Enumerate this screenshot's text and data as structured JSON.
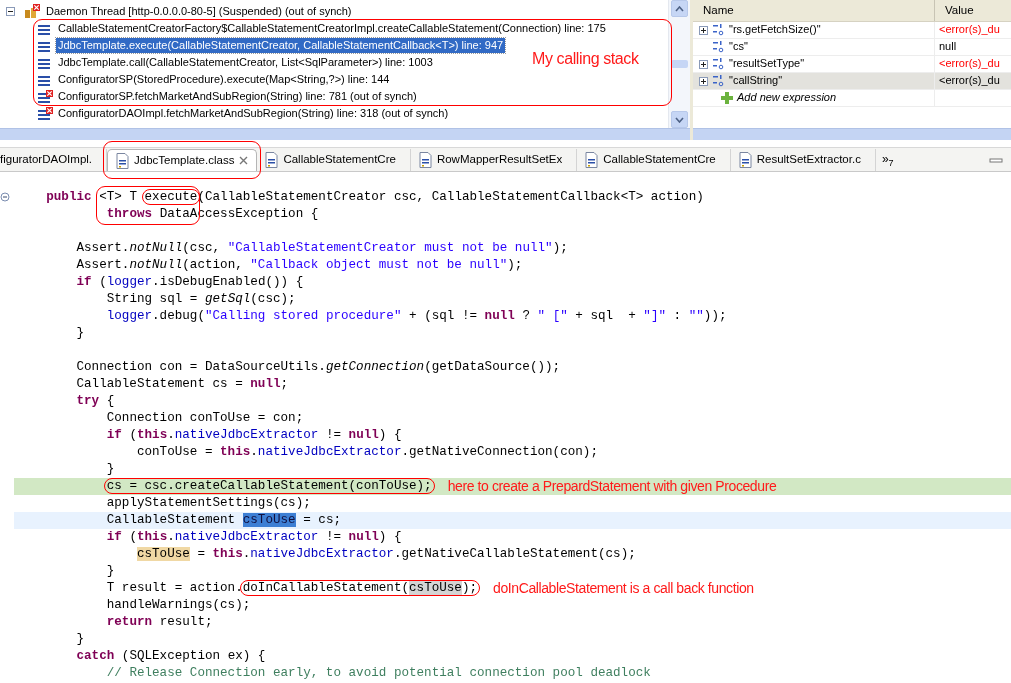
{
  "debug": {
    "threads": [
      {
        "label": "Daemon Thread [http-0.0.0.0-80-5] (Suspended) (out of synch)",
        "expanded": true,
        "out_of_synch": true,
        "children": [
          {
            "label": "CallableStatementCreatorFactory$CallableStatementCreatorImpl.createCallableStatement(Connection) line: 175",
            "selected": false,
            "out_of_synch": false,
            "circle": true
          },
          {
            "label": "JdbcTemplate.execute(CallableStatementCreator, CallableStatementCallback<T>) line: 947",
            "selected": true,
            "out_of_synch": false,
            "circle": true
          },
          {
            "label": "JdbcTemplate.call(CallableStatementCreator, List<SqlParameter>) line: 1003",
            "selected": false,
            "out_of_synch": false,
            "circle": true
          },
          {
            "label": "ConfiguratorSP(StoredProcedure).execute(Map<String,?>) line: 144",
            "selected": false,
            "out_of_synch": false,
            "circle": true
          },
          {
            "label": "ConfiguratorSP.fetchMarketAndSubRegion(String) line: 781 (out of synch)",
            "selected": false,
            "out_of_synch": true,
            "circle": true
          },
          {
            "label": "ConfiguratorDAOImpl.fetchMarketAndSubRegion(String) line: 318 (out of synch)",
            "selected": false,
            "out_of_synch": true,
            "circle": false
          }
        ]
      }
    ]
  },
  "stack_note": {
    "text": "My calling stack"
  },
  "expressions": {
    "columns": [
      "Name",
      "Value"
    ],
    "rows": [
      {
        "name": "\"rs.getFetchSize()\"",
        "value": "<error(s)_du",
        "kind": "error",
        "expandable": true,
        "selected": false
      },
      {
        "name": "\"cs\"",
        "value": "null",
        "kind": "plain",
        "expandable": false,
        "selected": false
      },
      {
        "name": "\"resultSetType\"",
        "value": "<error(s)_du",
        "kind": "error",
        "expandable": true,
        "selected": false
      },
      {
        "name": "\"callString\"",
        "value": "<error(s)_du",
        "kind": "error",
        "expandable": true,
        "selected": true
      }
    ],
    "add_label": "Add new expression"
  },
  "editor": {
    "tabs": [
      {
        "label": "figuratorDAOImpl.",
        "selected": false,
        "circle": false,
        "icon": false
      },
      {
        "label": "JdbcTemplate.class",
        "selected": true,
        "circle": true,
        "icon": true
      },
      {
        "label": "CallableStatementCre",
        "selected": false,
        "circle": false,
        "icon": true
      },
      {
        "label": "RowMapperResultSetEx",
        "selected": false,
        "circle": false,
        "icon": true
      },
      {
        "label": "CallableStatementCre",
        "selected": false,
        "circle": false,
        "icon": true
      },
      {
        "label": "ResultSetExtractor.c",
        "selected": false,
        "circle": false,
        "icon": true
      }
    ],
    "overflow": {
      "glyph": "»",
      "count": "7"
    },
    "lines": [
      {
        "kind": "code",
        "tokens": [
          {
            "t": "    public",
            "kind": "kw"
          },
          {
            "t": " <T> T ",
            "kind": "plain",
            "box": true
          },
          {
            "t": "execute",
            "kind": "plain",
            "box": true,
            "circle": true
          },
          {
            "t": "(CallableStatementCreator csc, CallableStatementCallback<T> action)",
            "kind": "plain"
          }
        ]
      },
      {
        "kind": "code",
        "tokens": [
          {
            "t": "            throws",
            "kind": "kw",
            "box": true
          },
          {
            "t": " DataAccessException {",
            "kind": "plain"
          }
        ]
      },
      {
        "kind": "blank"
      },
      {
        "kind": "code",
        "tokens": [
          {
            "t": "        Assert.",
            "kind": "plain"
          },
          {
            "t": "notNull",
            "kind": "italic"
          },
          {
            "t": "(csc, ",
            "kind": "plain"
          },
          {
            "t": "\"CallableStatementCreator must not be null\"",
            "kind": "string"
          },
          {
            "t": ");",
            "kind": "plain"
          }
        ]
      },
      {
        "kind": "code",
        "tokens": [
          {
            "t": "        Assert.",
            "kind": "plain"
          },
          {
            "t": "notNull",
            "kind": "italic"
          },
          {
            "t": "(action, ",
            "kind": "plain"
          },
          {
            "t": "\"Callback object must not be null\"",
            "kind": "string"
          },
          {
            "t": ");",
            "kind": "plain"
          }
        ]
      },
      {
        "kind": "code",
        "tokens": [
          {
            "t": "        if",
            "kind": "kw"
          },
          {
            "t": " (",
            "kind": "plain"
          },
          {
            "t": "logger",
            "kind": "field"
          },
          {
            "t": ".isDebugEnabled()) {",
            "kind": "plain"
          }
        ]
      },
      {
        "kind": "code",
        "tokens": [
          {
            "t": "            String sql = ",
            "kind": "plain"
          },
          {
            "t": "getSql",
            "kind": "italic"
          },
          {
            "t": "(csc);",
            "kind": "plain"
          }
        ]
      },
      {
        "kind": "code",
        "tokens": [
          {
            "t": "            logger",
            "kind": "field"
          },
          {
            "t": ".debug(",
            "kind": "plain"
          },
          {
            "t": "\"Calling stored procedure\"",
            "kind": "string"
          },
          {
            "t": " + (sql != ",
            "kind": "plain"
          },
          {
            "t": "null",
            "kind": "kw"
          },
          {
            "t": " ? ",
            "kind": "plain"
          },
          {
            "t": "\" [\"",
            "kind": "string"
          },
          {
            "t": " + sql  + ",
            "kind": "plain"
          },
          {
            "t": "\"]\"",
            "kind": "string"
          },
          {
            "t": " : ",
            "kind": "plain"
          },
          {
            "t": "\"\"",
            "kind": "string"
          },
          {
            "t": "));",
            "kind": "plain"
          }
        ]
      },
      {
        "kind": "code",
        "tokens": [
          {
            "t": "        }",
            "kind": "plain"
          }
        ]
      },
      {
        "kind": "blank"
      },
      {
        "kind": "code",
        "tokens": [
          {
            "t": "        Connection con = DataSourceUtils.",
            "kind": "plain"
          },
          {
            "t": "getConnection",
            "kind": "italic"
          },
          {
            "t": "(getDataSource());",
            "kind": "plain"
          }
        ]
      },
      {
        "kind": "code",
        "tokens": [
          {
            "t": "        CallableStatement cs = ",
            "kind": "plain"
          },
          {
            "t": "null",
            "kind": "kw"
          },
          {
            "t": ";",
            "kind": "plain"
          }
        ]
      },
      {
        "kind": "code",
        "tokens": [
          {
            "t": "        try",
            "kind": "kw"
          },
          {
            "t": " {",
            "kind": "plain"
          }
        ]
      },
      {
        "kind": "code",
        "tokens": [
          {
            "t": "            Connection conToUse = con;",
            "kind": "plain"
          }
        ]
      },
      {
        "kind": "code",
        "tokens": [
          {
            "t": "            if",
            "kind": "kw"
          },
          {
            "t": " (",
            "kind": "plain"
          },
          {
            "t": "this",
            "kind": "kw"
          },
          {
            "t": ".",
            "kind": "plain"
          },
          {
            "t": "nativeJdbcExtractor",
            "kind": "field"
          },
          {
            "t": " != ",
            "kind": "plain"
          },
          {
            "t": "null",
            "kind": "kw"
          },
          {
            "t": ") {",
            "kind": "plain"
          }
        ]
      },
      {
        "kind": "code",
        "tokens": [
          {
            "t": "                conToUse = ",
            "kind": "plain"
          },
          {
            "t": "this",
            "kind": "kw"
          },
          {
            "t": ".",
            "kind": "plain"
          },
          {
            "t": "nativeJdbcExtractor",
            "kind": "field"
          },
          {
            "t": ".getNativeConnection(con);",
            "kind": "plain"
          }
        ]
      },
      {
        "kind": "code",
        "tokens": [
          {
            "t": "            }",
            "kind": "plain"
          }
        ]
      },
      {
        "kind": "current_line",
        "tokens": [
          {
            "t": "            cs = csc.createCallableStatement(conToUse);",
            "kind": "plain",
            "circle": true
          }
        ],
        "note": "here to create a PrepardStatement with given Procedure"
      },
      {
        "kind": "code",
        "tokens": [
          {
            "t": "            applyStatementSettings(cs);",
            "kind": "plain"
          }
        ]
      },
      {
        "kind": "cursor_line",
        "tokens": [
          {
            "t": "            CallableStatement ",
            "kind": "plain"
          },
          {
            "t": "csToUse",
            "kind": "selection"
          },
          {
            "t": " = cs;",
            "kind": "plain"
          }
        ]
      },
      {
        "kind": "code",
        "tokens": [
          {
            "t": "            if",
            "kind": "kw"
          },
          {
            "t": " (",
            "kind": "plain"
          },
          {
            "t": "this",
            "kind": "kw"
          },
          {
            "t": ".",
            "kind": "plain"
          },
          {
            "t": "nativeJdbcExtractor",
            "kind": "field"
          },
          {
            "t": " != ",
            "kind": "plain"
          },
          {
            "t": "null",
            "kind": "kw"
          },
          {
            "t": ") {",
            "kind": "plain"
          }
        ]
      },
      {
        "kind": "code",
        "tokens": [
          {
            "t": "                csToUse",
            "kind": "write_occurrence"
          },
          {
            "t": " = ",
            "kind": "plain"
          },
          {
            "t": "this",
            "kind": "kw"
          },
          {
            "t": ".",
            "kind": "plain"
          },
          {
            "t": "nativeJdbcExtractor",
            "kind": "field"
          },
          {
            "t": ".getNativeCallableStatement(cs);",
            "kind": "plain"
          }
        ]
      },
      {
        "kind": "code",
        "tokens": [
          {
            "t": "            }",
            "kind": "plain"
          }
        ]
      },
      {
        "kind": "code",
        "tokens": [
          {
            "t": "            T result = action.",
            "kind": "plain"
          },
          {
            "t": "doInCallableStatement(",
            "kind": "plain",
            "circle": true
          },
          {
            "t": "csToUse",
            "kind": "read_occurrence",
            "circle": true
          },
          {
            "t": ");",
            "kind": "plain",
            "circle": true
          }
        ],
        "note": "doInCallableStatement is a call back function"
      },
      {
        "kind": "code",
        "tokens": [
          {
            "t": "            handleWarnings(cs);",
            "kind": "plain"
          }
        ]
      },
      {
        "kind": "code",
        "tokens": [
          {
            "t": "            return",
            "kind": "kw"
          },
          {
            "t": " result;",
            "kind": "plain"
          }
        ]
      },
      {
        "kind": "code",
        "tokens": [
          {
            "t": "        }",
            "kind": "plain"
          }
        ]
      },
      {
        "kind": "code",
        "tokens": [
          {
            "t": "        catch",
            "kind": "kw"
          },
          {
            "t": " (SQLException ex) {",
            "kind": "plain"
          }
        ]
      },
      {
        "kind": "code",
        "tokens": [
          {
            "t": "            // Release Connection early, to avoid potential connection pool deadlock",
            "kind": "comment"
          }
        ]
      }
    ]
  }
}
